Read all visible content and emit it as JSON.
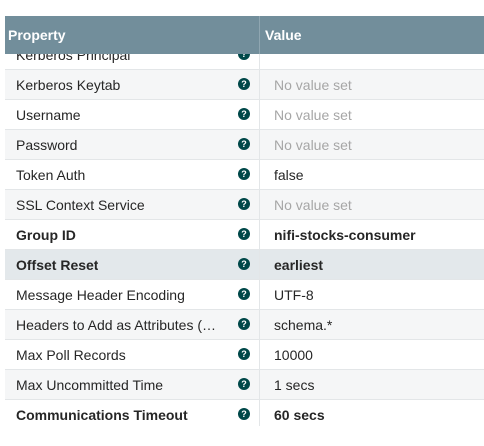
{
  "table": {
    "header": {
      "property": "Property",
      "value": "Value"
    },
    "help_glyph": "?",
    "rows": [
      {
        "name": "Kerberos Principal",
        "value": "",
        "bold": false,
        "empty": false
      },
      {
        "name": "Kerberos Keytab",
        "value": "No value set",
        "bold": false,
        "empty": true
      },
      {
        "name": "Username",
        "value": "No value set",
        "bold": false,
        "empty": true
      },
      {
        "name": "Password",
        "value": "No value set",
        "bold": false,
        "empty": true
      },
      {
        "name": "Token Auth",
        "value": "false",
        "bold": false,
        "empty": false
      },
      {
        "name": "SSL Context Service",
        "value": "No value set",
        "bold": false,
        "empty": true
      },
      {
        "name": "Group ID",
        "value": "nifi-stocks-consumer",
        "bold": true,
        "empty": false
      },
      {
        "name": "Offset Reset",
        "value": "earliest",
        "bold": true,
        "empty": false,
        "selected": true
      },
      {
        "name": "Message Header Encoding",
        "value": "UTF-8",
        "bold": false,
        "empty": false
      },
      {
        "name": "Headers to Add as Attributes (Regex)",
        "value": "schema.*",
        "bold": false,
        "empty": false
      },
      {
        "name": "Max Poll Records",
        "value": "10000",
        "bold": false,
        "empty": false
      },
      {
        "name": "Max Uncommitted Time",
        "value": "1 secs",
        "bold": false,
        "empty": false
      },
      {
        "name": "Communications Timeout",
        "value": "60 secs",
        "bold": true,
        "empty": false
      }
    ]
  },
  "colors": {
    "header_bg": "#728e9b",
    "help_icon": "#004849",
    "selected_row": "#e3e8eb",
    "empty_value": "#a6a6a6"
  }
}
